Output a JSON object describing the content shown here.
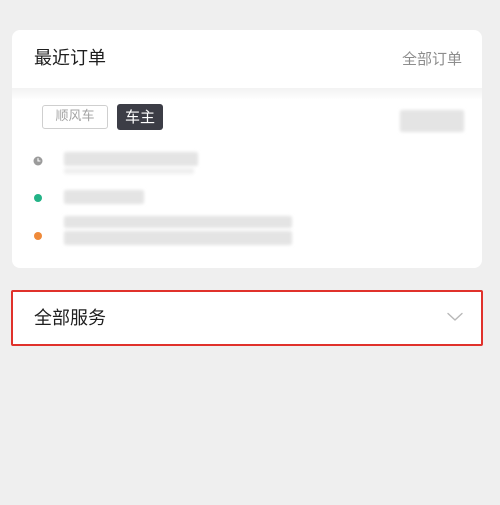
{
  "orders": {
    "title": "最近订单",
    "all_link": "全部订单",
    "tags": {
      "rideshare": "顺风车",
      "owner": "车主"
    }
  },
  "services": {
    "title": "全部服务"
  },
  "colors": {
    "owner_tag_bg": "#3c3d46",
    "start_dot": "#23b387",
    "end_dot": "#ef8a3a",
    "time_dot": "#9b9b9b",
    "highlight_border": "#e0312b"
  },
  "icons": {
    "time": "clock-icon",
    "start": "start-location-dot",
    "end": "destination-location-dot",
    "expand": "chevron-down-icon"
  }
}
